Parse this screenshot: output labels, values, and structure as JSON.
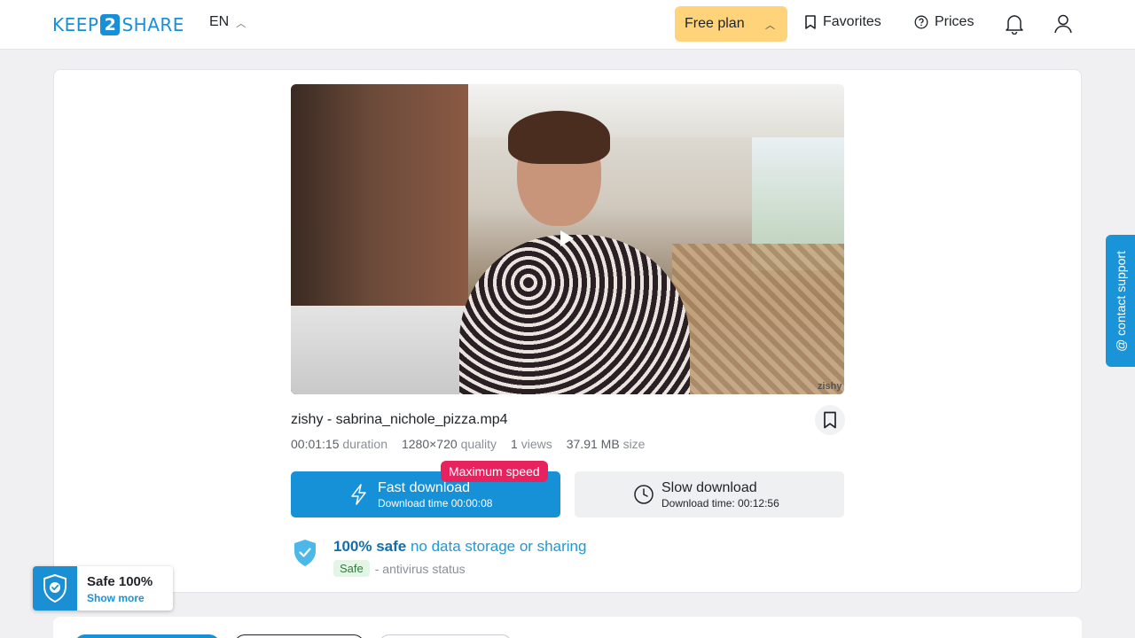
{
  "header": {
    "logo": {
      "left": "KEEP",
      "mid": "2",
      "right": "SHARE"
    },
    "lang": "EN",
    "plan_label": "Free plan",
    "favorites_label": "Favorites",
    "prices_label": "Prices"
  },
  "file": {
    "title": "zishy - sabrina_nichole_pizza.mp4",
    "duration_value": "00:01:15",
    "duration_label": "duration",
    "quality_value": "1280×720",
    "quality_label": "quality",
    "views_value": "1",
    "views_label": "views",
    "size_value": "37.91 MB",
    "size_label": "size",
    "watermark": "zishy"
  },
  "download": {
    "badge": "Maximum speed",
    "fast_label": "Fast download",
    "fast_time": "Download time 00:00:08",
    "slow_label": "Slow download",
    "slow_time": "Download time: 00:12:56"
  },
  "safety": {
    "strong": "100% safe",
    "light": "no data storage or sharing",
    "tag": "Safe",
    "status": "- antivirus status"
  },
  "support_label": "@ contact support",
  "safe_widget": {
    "title": "Safe 100%",
    "link": "Show more"
  },
  "colors": {
    "accent": "#1691d8",
    "plan": "#ffd37a",
    "badge": "#e8215f"
  }
}
